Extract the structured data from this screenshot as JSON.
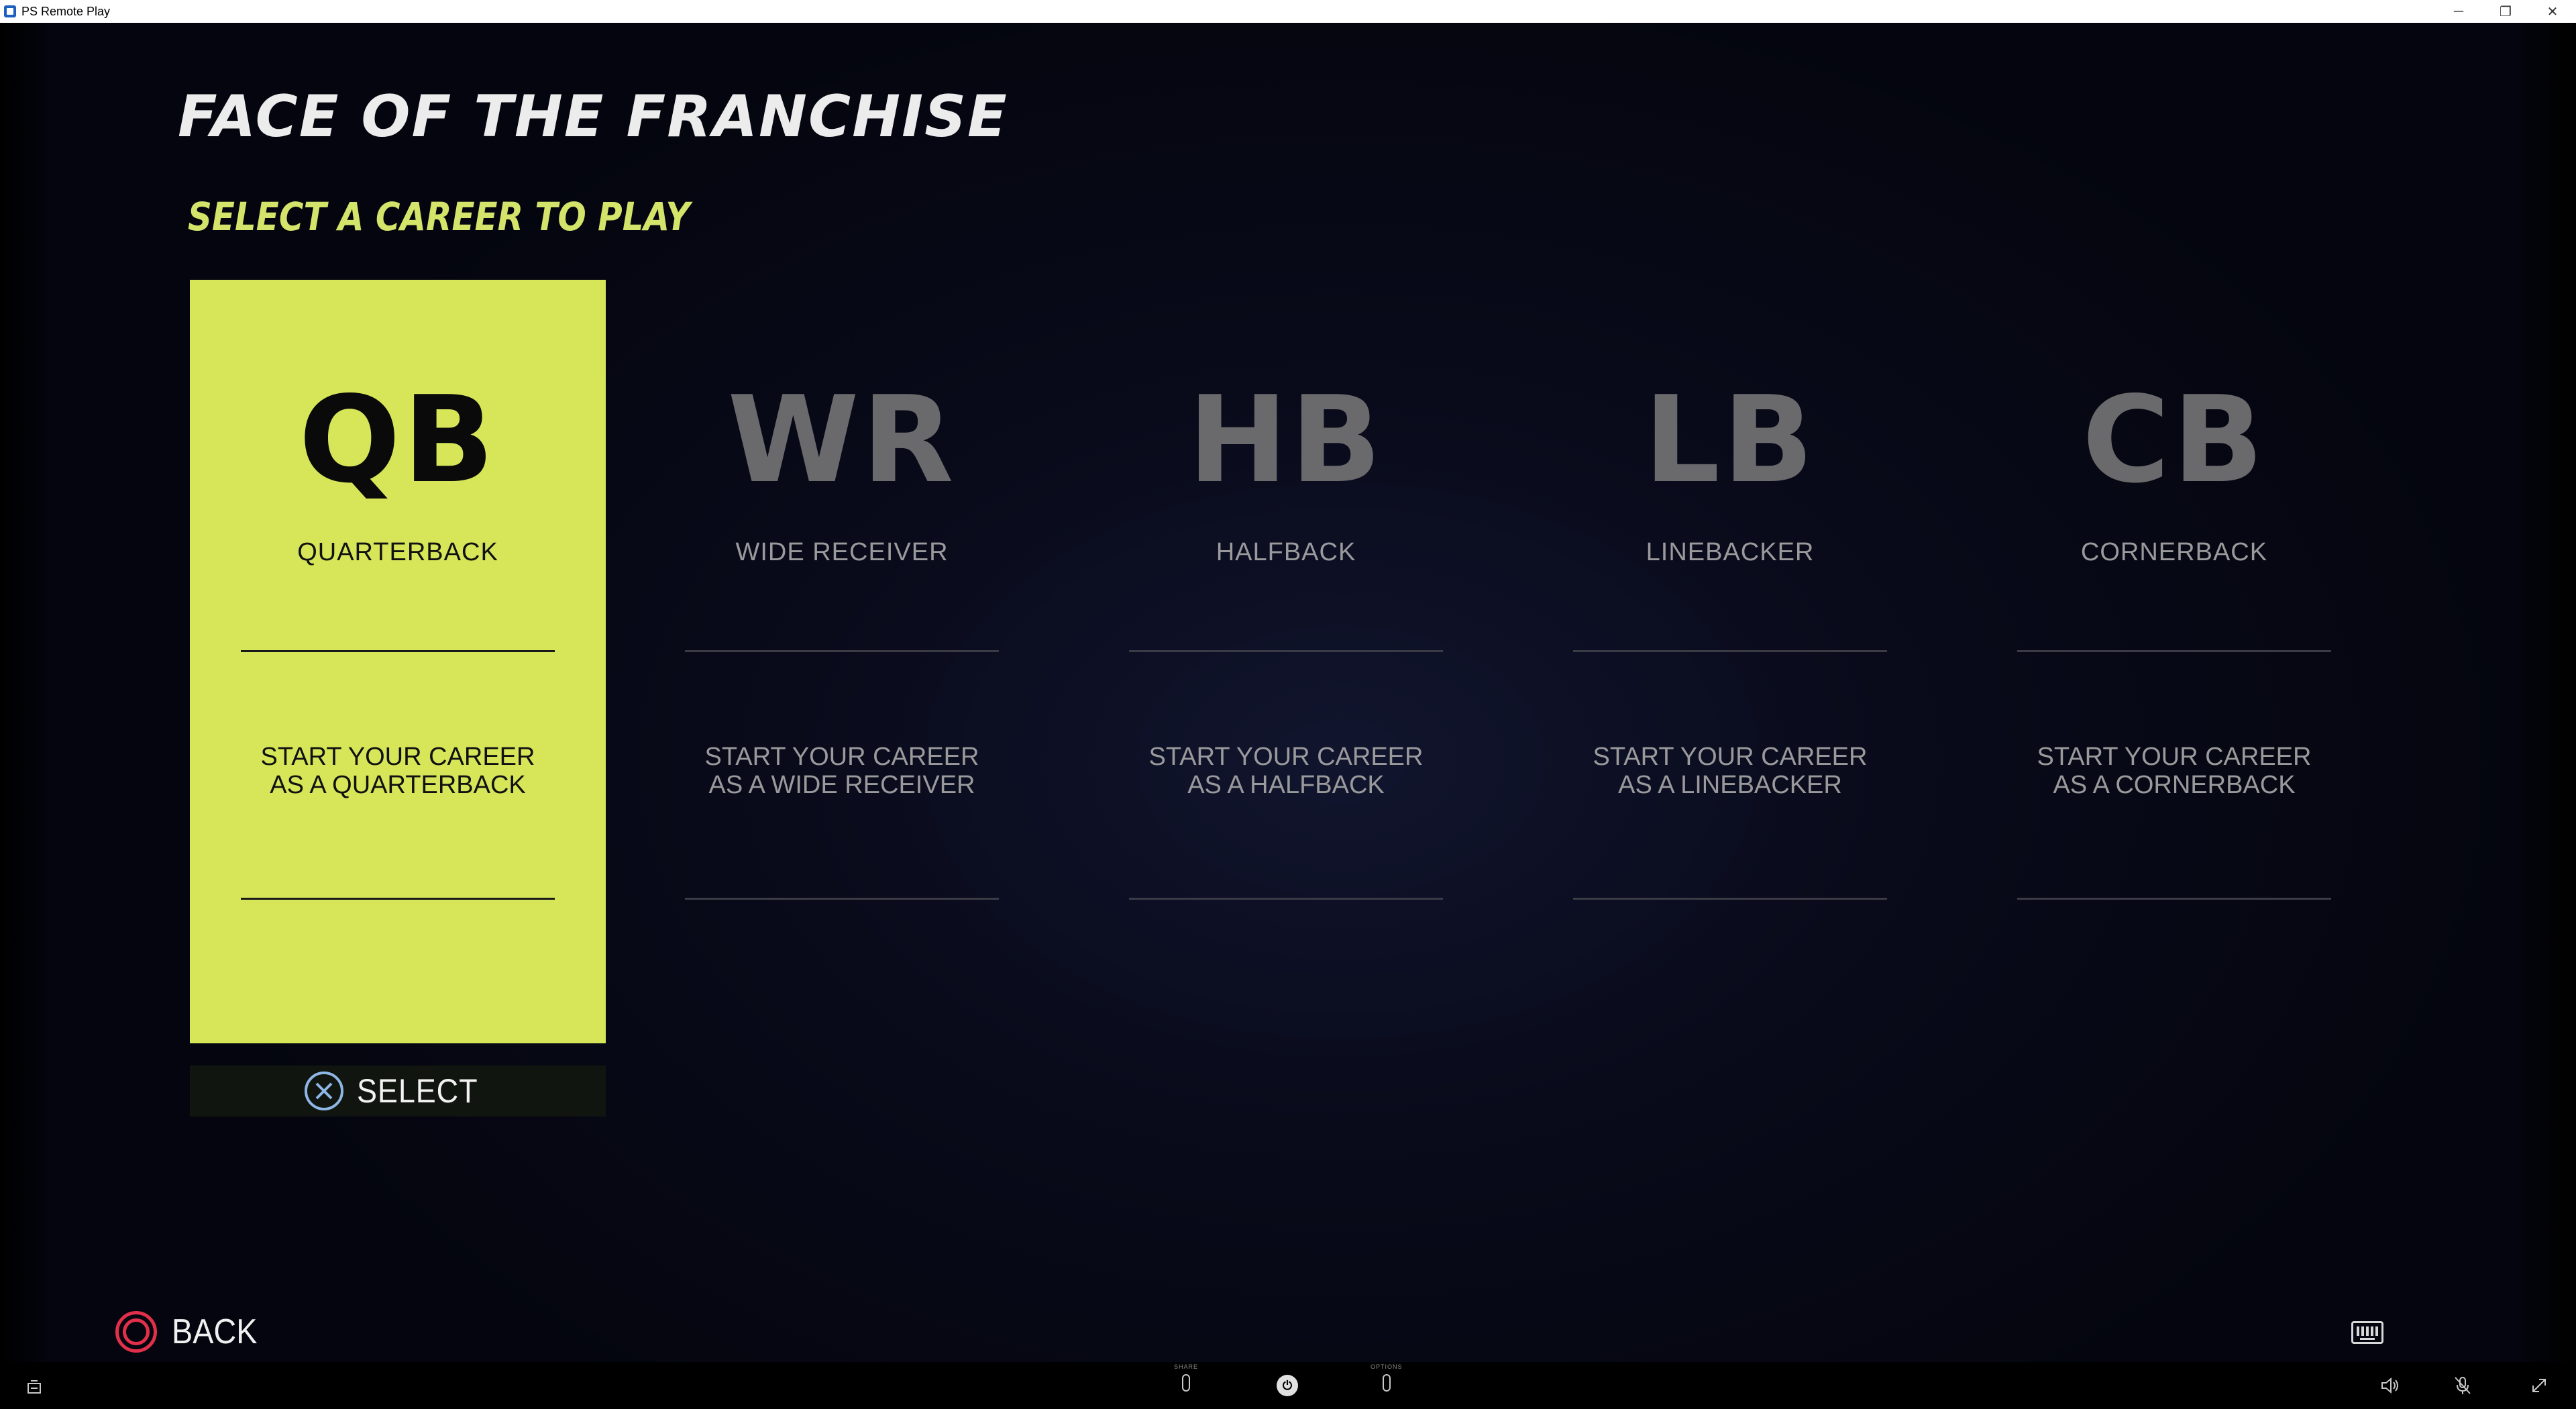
{
  "window": {
    "title": "PS Remote Play",
    "controls": {
      "minimize": "─",
      "restore": "❐",
      "close": "✕"
    }
  },
  "screen": {
    "title": "FACE OF THE FRANCHISE",
    "subtitle": "SELECT A CAREER TO PLAY"
  },
  "careers": [
    {
      "abbr": "QB",
      "name": "QUARTERBACK",
      "description": "START YOUR CAREER\nAS A QUARTERBACK",
      "selected": true
    },
    {
      "abbr": "WR",
      "name": "WIDE RECEIVER",
      "description": "START YOUR CAREER\nAS A WIDE RECEIVER",
      "selected": false
    },
    {
      "abbr": "HB",
      "name": "HALFBACK",
      "description": "START YOUR CAREER\nAS A HALFBACK",
      "selected": false
    },
    {
      "abbr": "LB",
      "name": "LINEBACKER",
      "description": "START YOUR CAREER\nAS A LINEBACKER",
      "selected": false
    },
    {
      "abbr": "CB",
      "name": "CORNERBACK",
      "description": "START YOUR CAREER\nAS A CORNERBACK",
      "selected": false
    }
  ],
  "prompts": {
    "select_label": "SELECT",
    "select_button_icon": "cross-button-icon",
    "back_label": "BACK",
    "back_button_icon": "circle-button-icon"
  },
  "taskbar": {
    "share_label": "SHARE",
    "options_label": "OPTIONS",
    "icons": [
      "controller-icon",
      "share-button-icon",
      "ps-button-icon",
      "options-button-icon",
      "volume-icon",
      "mic-muted-icon",
      "fullscreen-icon"
    ]
  },
  "colors": {
    "accent": "#d6e658",
    "subtitle": "#d4e36a",
    "cross": "#8fb7e6",
    "circle": "#e2304a",
    "background": "#0a0c1e"
  }
}
